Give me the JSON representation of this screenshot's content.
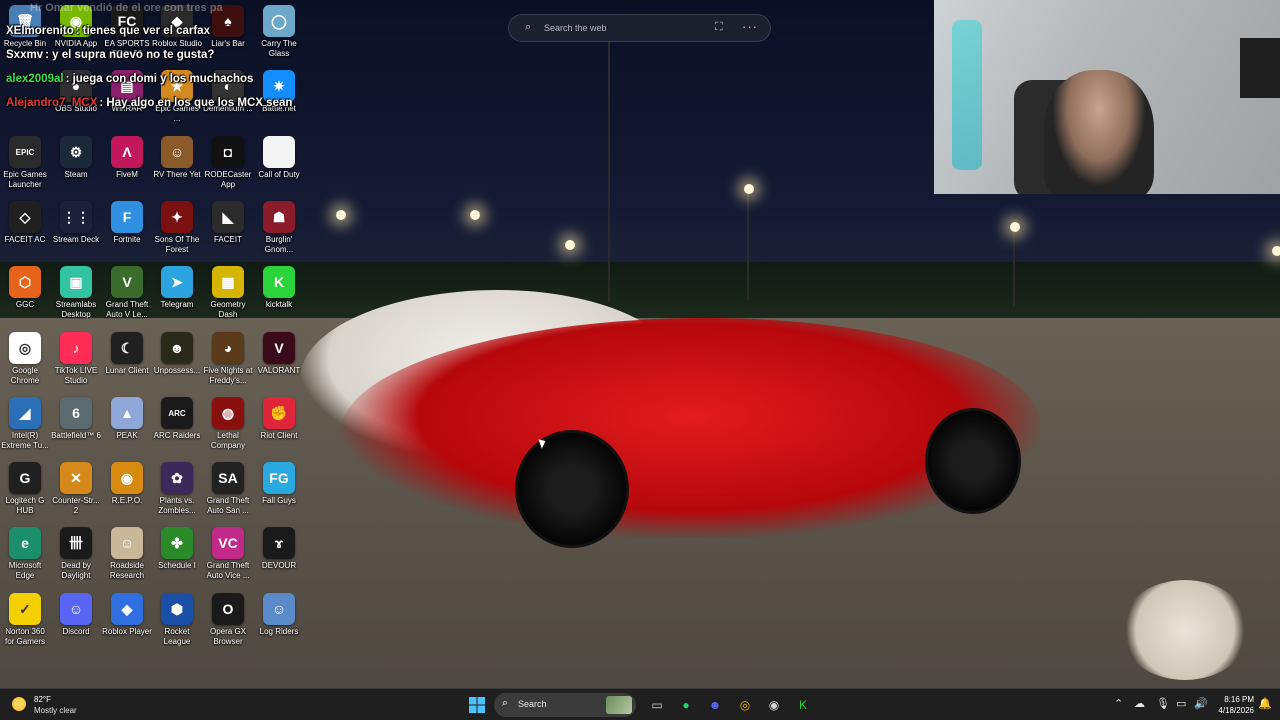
{
  "websearch": {
    "placeholder": "Search the web",
    "more": "···"
  },
  "chat": {
    "top_faded": "Hr Omar vendió de el ore con tres pa",
    "messages": [
      {
        "user": "XElmorenito",
        "text": ": tienes que ver el carfax",
        "color": "#ffffff"
      },
      {
        "user": "Sxxmv",
        "text": ": y el supra nuevo no te gusta?",
        "color": "#ffffff"
      },
      {
        "user": "alex2009al",
        "text": ": juega con domi y los muchachos",
        "color": "#37e04a"
      },
      {
        "user": "Alejandro7_MCX",
        "text": ": Hay algo en los que los MCX sean",
        "color": "#e23a3a"
      }
    ]
  },
  "desktop_icons": [
    {
      "label": "Recycle Bin",
      "icon": "recycle-bin-icon",
      "bg": "#4a7fb5",
      "glyph": "🗑",
      "col": 0,
      "row": 0
    },
    {
      "label": "NVIDIA App",
      "icon": "nvidia-icon",
      "bg": "#76b900",
      "glyph": "◉",
      "col": 1,
      "row": 0
    },
    {
      "label": "EA SPORTS FC™ 26",
      "icon": "ea-sports-icon",
      "bg": "#1a1a1a",
      "glyph": "FC",
      "col": 2,
      "row": 0
    },
    {
      "label": "Roblox Studio",
      "icon": "roblox-studio-icon",
      "bg": "#2a2a2a",
      "glyph": "◆",
      "col": 3,
      "row": 0
    },
    {
      "label": "Liar's Bar",
      "icon": "liars-bar-icon",
      "bg": "#3d0f0f",
      "glyph": "♠",
      "col": 4,
      "row": 0
    },
    {
      "label": "Carry The Glass",
      "icon": "carry-the-glass-icon",
      "bg": "#6da7c9",
      "glyph": "◯",
      "col": 5,
      "row": 0
    },
    {
      "label": "OBS Studio",
      "icon": "obs-icon",
      "bg": "#302e31",
      "glyph": "●",
      "col": 1,
      "row": 1
    },
    {
      "label": "WinRAR",
      "icon": "winrar-icon",
      "bg": "#8a1f6c",
      "glyph": "▤",
      "col": 2,
      "row": 1
    },
    {
      "label": "Epic Games ...",
      "icon": "games-icon",
      "bg": "#d28a20",
      "glyph": "★",
      "col": 3,
      "row": 1
    },
    {
      "label": "Dementium ...",
      "icon": "game-icon",
      "bg": "#333333",
      "glyph": "◐",
      "col": 4,
      "row": 1
    },
    {
      "label": "Battle.net",
      "icon": "battlenet-icon",
      "bg": "#148eff",
      "glyph": "✷",
      "col": 5,
      "row": 1
    },
    {
      "label": "Epic Games Launcher",
      "icon": "epic-games-icon",
      "bg": "#2a2a2a",
      "glyph": "EPIC",
      "col": 0,
      "row": 2
    },
    {
      "label": "Steam",
      "icon": "steam-icon",
      "bg": "#1b2838",
      "glyph": "⚙",
      "col": 1,
      "row": 2
    },
    {
      "label": "FiveM",
      "icon": "fivem-icon",
      "bg": "#c2185b",
      "glyph": "Λ",
      "col": 2,
      "row": 2
    },
    {
      "label": "RV There Yet",
      "icon": "rv-there-yet-icon",
      "bg": "#8b5a2b",
      "glyph": "☺",
      "col": 3,
      "row": 2
    },
    {
      "label": "RODECaster App",
      "icon": "rodecaster-icon",
      "bg": "#111111",
      "glyph": "◘",
      "col": 4,
      "row": 2
    },
    {
      "label": "Call of Duty",
      "icon": "file-icon",
      "bg": "#f4f4f4",
      "glyph": "",
      "col": 5,
      "row": 2
    },
    {
      "label": "FACEIT AC",
      "icon": "faceit-ac-icon",
      "bg": "#202020",
      "glyph": "◇",
      "col": 0,
      "row": 3
    },
    {
      "label": "Stream Deck",
      "icon": "stream-deck-icon",
      "bg": "#1b1f3a",
      "glyph": "⋮⋮",
      "col": 1,
      "row": 3
    },
    {
      "label": "Fortnite",
      "icon": "fortnite-icon",
      "bg": "#2f8fe0",
      "glyph": "F",
      "col": 2,
      "row": 3
    },
    {
      "label": "Sons Of The Forest",
      "icon": "sons-of-the-forest-icon",
      "bg": "#7a1010",
      "glyph": "✦",
      "col": 3,
      "row": 3
    },
    {
      "label": "FACEIT",
      "icon": "faceit-icon",
      "bg": "#2b2b2b",
      "glyph": "◣",
      "col": 4,
      "row": 3
    },
    {
      "label": "Burglin' Gnom...",
      "icon": "burglin-gnomes-icon",
      "bg": "#8b1a2a",
      "glyph": "☗",
      "col": 5,
      "row": 3
    },
    {
      "label": "GGC",
      "icon": "ggc-icon",
      "bg": "#e8631a",
      "glyph": "⬡",
      "col": 0,
      "row": 4
    },
    {
      "label": "Streamlabs Desktop",
      "icon": "streamlabs-icon",
      "bg": "#31c3a2",
      "glyph": "▣",
      "col": 1,
      "row": 4
    },
    {
      "label": "Grand Theft Auto V Le...",
      "icon": "gta-v-icon",
      "bg": "#3a6b2a",
      "glyph": "V",
      "col": 2,
      "row": 4
    },
    {
      "label": "Telegram",
      "icon": "telegram-icon",
      "bg": "#2aa3de",
      "glyph": "➤",
      "col": 3,
      "row": 4
    },
    {
      "label": "Geometry Dash",
      "icon": "geometry-dash-icon",
      "bg": "#d6b500",
      "glyph": "▦",
      "col": 4,
      "row": 4
    },
    {
      "label": "kicktalk",
      "icon": "kicktalk-icon",
      "bg": "#2bd43a",
      "glyph": "K",
      "col": 5,
      "row": 4
    },
    {
      "label": "Google Chrome",
      "icon": "chrome-icon",
      "bg": "#ffffff",
      "glyph": "◎",
      "col": 0,
      "row": 5
    },
    {
      "label": "TikTok LIVE Studio",
      "icon": "tiktok-icon",
      "bg": "#ff2d55",
      "glyph": "♪",
      "col": 1,
      "row": 5
    },
    {
      "label": "Lunar Client",
      "icon": "lunar-client-icon",
      "bg": "#202020",
      "glyph": "☾",
      "col": 2,
      "row": 5
    },
    {
      "label": "Unpossess...",
      "icon": "unpossess-icon",
      "bg": "#2a2a1a",
      "glyph": "☻",
      "col": 3,
      "row": 5
    },
    {
      "label": "Five Nights at Freddy's...",
      "icon": "fnaf-icon",
      "bg": "#5a3a1a",
      "glyph": "◕",
      "col": 4,
      "row": 5
    },
    {
      "label": "VALORANT",
      "icon": "valorant-icon",
      "bg": "#3a0a1a",
      "glyph": "V",
      "col": 5,
      "row": 5
    },
    {
      "label": "Intel(R) Extreme Tu...",
      "icon": "intel-xtu-icon",
      "bg": "#2a6fb8",
      "glyph": "◢",
      "col": 0,
      "row": 6
    },
    {
      "label": "Battlefield™ 6",
      "icon": "battlefield-icon",
      "bg": "#5a6a70",
      "glyph": "6",
      "col": 1,
      "row": 6
    },
    {
      "label": "PEAK",
      "icon": "peak-icon",
      "bg": "#8fa6d8",
      "glyph": "▲",
      "col": 2,
      "row": 6
    },
    {
      "label": "ARC Raiders",
      "icon": "arc-raiders-icon",
      "bg": "#1a1a1a",
      "glyph": "ARC",
      "col": 3,
      "row": 6
    },
    {
      "label": "Lethal Company",
      "icon": "lethal-company-icon",
      "bg": "#8a1010",
      "glyph": "◍",
      "col": 4,
      "row": 6
    },
    {
      "label": "Riot Client",
      "icon": "riot-client-icon",
      "bg": "#e0253a",
      "glyph": "✊",
      "col": 5,
      "row": 6
    },
    {
      "label": "Logitech G HUB",
      "icon": "logitech-icon",
      "bg": "#202020",
      "glyph": "G",
      "col": 0,
      "row": 7
    },
    {
      "label": "Counter-Str... 2",
      "icon": "counter-strike-icon",
      "bg": "#d6891a",
      "glyph": "✕",
      "col": 1,
      "row": 7
    },
    {
      "label": "R.E.P.O.",
      "icon": "repo-icon",
      "bg": "#d68a10",
      "glyph": "◉",
      "col": 2,
      "row": 7
    },
    {
      "label": "Plants vs. Zombies...",
      "icon": "plants-vs-zombies-icon",
      "bg": "#3a2a5a",
      "glyph": "✿",
      "col": 3,
      "row": 7
    },
    {
      "label": "Grand Theft Auto San ...",
      "icon": "gta-sa-icon",
      "bg": "#222222",
      "glyph": "SA",
      "col": 4,
      "row": 7
    },
    {
      "label": "Fall Guys",
      "icon": "fall-guys-icon",
      "bg": "#2aa8e0",
      "glyph": "FG",
      "col": 5,
      "row": 7
    },
    {
      "label": "Microsoft Edge",
      "icon": "edge-icon",
      "bg": "#1a8f6a",
      "glyph": "e",
      "col": 0,
      "row": 8
    },
    {
      "label": "Dead by Daylight",
      "icon": "dead-by-daylight-icon",
      "bg": "#1a1a1a",
      "glyph": "卌",
      "col": 1,
      "row": 8
    },
    {
      "label": "Roadside Research",
      "icon": "roadside-research-icon",
      "bg": "#c8b89a",
      "glyph": "☺",
      "col": 2,
      "row": 8
    },
    {
      "label": "Schedule I",
      "icon": "schedule-i-icon",
      "bg": "#2a8a2a",
      "glyph": "✤",
      "col": 3,
      "row": 8
    },
    {
      "label": "Grand Theft Auto Vice ...",
      "icon": "gta-vc-icon",
      "bg": "#c22a8a",
      "glyph": "VC",
      "col": 4,
      "row": 8
    },
    {
      "label": "DEVOUR",
      "icon": "devour-icon",
      "bg": "#1a1a1a",
      "glyph": "ɤ",
      "col": 5,
      "row": 8
    },
    {
      "label": "Norton 360 for Gamers",
      "icon": "norton-icon",
      "bg": "#f5d000",
      "glyph": "✓",
      "col": 0,
      "row": 9
    },
    {
      "label": "Discord",
      "icon": "discord-icon",
      "bg": "#5865f2",
      "glyph": "☺",
      "col": 1,
      "row": 9
    },
    {
      "label": "Roblox Player",
      "icon": "roblox-player-icon",
      "bg": "#2f6fe0",
      "glyph": "◆",
      "col": 2,
      "row": 9
    },
    {
      "label": "Rocket League",
      "icon": "rocket-league-icon",
      "bg": "#1a4fa8",
      "glyph": "⬢",
      "col": 3,
      "row": 9
    },
    {
      "label": "Opera GX Browser",
      "icon": "opera-gx-icon",
      "bg": "#1a1a1a",
      "glyph": "O",
      "col": 4,
      "row": 9
    },
    {
      "label": "Log Riders",
      "icon": "log-riders-icon",
      "bg": "#5a8ac8",
      "glyph": "☺",
      "col": 5,
      "row": 9
    }
  ],
  "taskbar": {
    "weather": {
      "temp": "82°F",
      "condition": "Mostly clear"
    },
    "search_label": "Search",
    "pinned": [
      {
        "name": "file-explorer-icon",
        "glyph": "▭",
        "color": "#d0d0d0"
      },
      {
        "name": "spotify-icon",
        "glyph": "●",
        "color": "#1ed760"
      },
      {
        "name": "discord-icon",
        "glyph": "☻",
        "color": "#5865f2"
      },
      {
        "name": "chrome-icon",
        "glyph": "◎",
        "color": "#f4b400"
      },
      {
        "name": "obs-icon",
        "glyph": "◉",
        "color": "#d0d0d0"
      },
      {
        "name": "kicktalk-icon",
        "glyph": "K",
        "color": "#2bd43a"
      }
    ],
    "time": "8:16 PM",
    "date": "4/18/2026"
  }
}
